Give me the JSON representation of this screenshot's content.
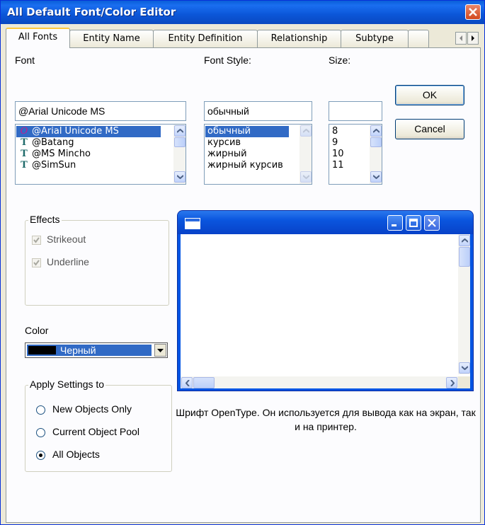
{
  "window": {
    "title": "All Default Font/Color Editor"
  },
  "tabs": [
    "All Fonts",
    "Entity Name",
    "Entity Definition",
    "Relationship",
    "Subtype"
  ],
  "font": {
    "label": "Font",
    "value": "@Arial Unicode MS",
    "list": [
      {
        "name": "@Arial Unicode MS",
        "icon": "opentype-font-icon",
        "selected": true
      },
      {
        "name": "@Batang",
        "icon": "truetype-font-icon",
        "selected": false
      },
      {
        "name": "@MS Mincho",
        "icon": "truetype-font-icon",
        "selected": false
      },
      {
        "name": "@SimSun",
        "icon": "truetype-font-icon",
        "selected": false
      }
    ]
  },
  "style": {
    "label": "Font Style:",
    "value": "обычный",
    "list": [
      "обычный",
      "курсив",
      "жирный",
      "жирный курсив"
    ],
    "selected": "обычный"
  },
  "size": {
    "label": "Size:",
    "value": "",
    "list": [
      "8",
      "9",
      "10",
      "11"
    ]
  },
  "buttons": {
    "ok": "OK",
    "cancel": "Cancel"
  },
  "effects": {
    "title": "Effects",
    "strikeout": {
      "label": "Strikeout",
      "checked": true,
      "disabled": true
    },
    "underline": {
      "label": "Underline",
      "checked": true,
      "disabled": true
    }
  },
  "color": {
    "label": "Color",
    "value": "Черный",
    "swatch": "#000000"
  },
  "apply": {
    "title": "Apply Settings to",
    "options": [
      {
        "label": "New Objects Only",
        "checked": false
      },
      {
        "label": "Current Object Pool",
        "checked": false
      },
      {
        "label": "All Objects",
        "checked": true
      }
    ]
  },
  "description": "Шрифт OpenType. Он используется для вывода как на экран, так и на принтер.",
  "colors": {
    "accent": "#0054e3",
    "selection": "#316ac5",
    "dialog_bg": "#ece9d8",
    "panel_bg": "#fcfcfe"
  }
}
